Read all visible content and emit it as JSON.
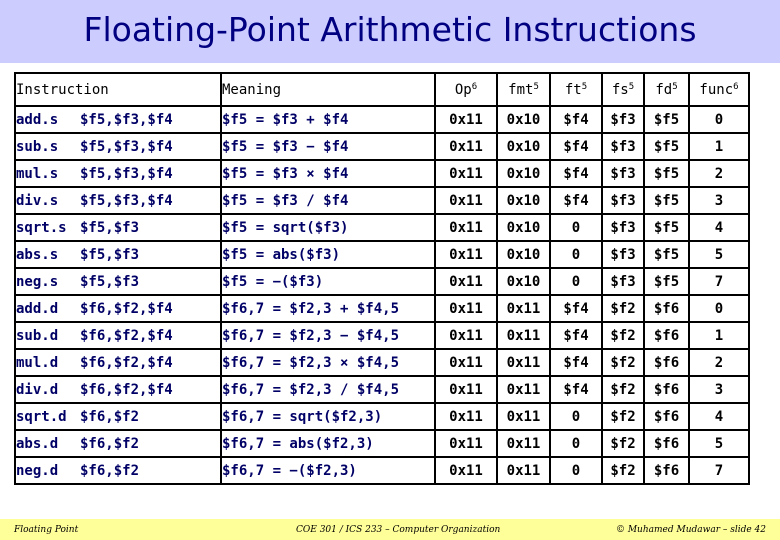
{
  "slide": {
    "title": "Floating-Point Arithmetic Instructions",
    "colors": {
      "title_bg": "#ccccff",
      "title_text": "#000080",
      "instruction_text": "#000066",
      "footer_bg": "#ffff99"
    }
  },
  "table": {
    "headers": {
      "instruction": "Instruction",
      "meaning": "Meaning",
      "op": {
        "label": "Op",
        "bits": "6"
      },
      "fmt": {
        "label": "fmt",
        "bits": "5"
      },
      "ft": {
        "label": "ft",
        "bits": "5"
      },
      "fs": {
        "label": "fs",
        "bits": "5"
      },
      "fd": {
        "label": "fd",
        "bits": "5"
      },
      "func": {
        "label": "func",
        "bits": "6"
      }
    },
    "rows": [
      {
        "mnemonic": "add.s",
        "operands": "$f5,$f3,$f4",
        "meaning": "$f5 = $f3 + $f4",
        "op": "0x11",
        "fmt": "0x10",
        "ft": "$f4",
        "fs": "$f3",
        "fd": "$f5",
        "func": "0"
      },
      {
        "mnemonic": "sub.s",
        "operands": "$f5,$f3,$f4",
        "meaning": "$f5 = $f3 − $f4",
        "op": "0x11",
        "fmt": "0x10",
        "ft": "$f4",
        "fs": "$f3",
        "fd": "$f5",
        "func": "1"
      },
      {
        "mnemonic": "mul.s",
        "operands": "$f5,$f3,$f4",
        "meaning": "$f5 = $f3 × $f4",
        "op": "0x11",
        "fmt": "0x10",
        "ft": "$f4",
        "fs": "$f3",
        "fd": "$f5",
        "func": "2"
      },
      {
        "mnemonic": "div.s",
        "operands": "$f5,$f3,$f4",
        "meaning": "$f5 = $f3 / $f4",
        "op": "0x11",
        "fmt": "0x10",
        "ft": "$f4",
        "fs": "$f3",
        "fd": "$f5",
        "func": "3"
      },
      {
        "mnemonic": "sqrt.s",
        "operands": "$f5,$f3",
        "meaning": "$f5 = sqrt($f3)",
        "op": "0x11",
        "fmt": "0x10",
        "ft": "0",
        "fs": "$f3",
        "fd": "$f5",
        "func": "4"
      },
      {
        "mnemonic": "abs.s",
        "operands": "$f5,$f3",
        "meaning": "$f5 = abs($f3)",
        "op": "0x11",
        "fmt": "0x10",
        "ft": "0",
        "fs": "$f3",
        "fd": "$f5",
        "func": "5"
      },
      {
        "mnemonic": "neg.s",
        "operands": "$f5,$f3",
        "meaning": "$f5 = −($f3)",
        "op": "0x11",
        "fmt": "0x10",
        "ft": "0",
        "fs": "$f3",
        "fd": "$f5",
        "func": "7"
      },
      {
        "mnemonic": "add.d",
        "operands": "$f6,$f2,$f4",
        "meaning": "$f6,7 = $f2,3 + $f4,5",
        "op": "0x11",
        "fmt": "0x11",
        "ft": "$f4",
        "fs": "$f2",
        "fd": "$f6",
        "func": "0"
      },
      {
        "mnemonic": "sub.d",
        "operands": "$f6,$f2,$f4",
        "meaning": "$f6,7 = $f2,3 − $f4,5",
        "op": "0x11",
        "fmt": "0x11",
        "ft": "$f4",
        "fs": "$f2",
        "fd": "$f6",
        "func": "1"
      },
      {
        "mnemonic": "mul.d",
        "operands": "$f6,$f2,$f4",
        "meaning": "$f6,7 = $f2,3 × $f4,5",
        "op": "0x11",
        "fmt": "0x11",
        "ft": "$f4",
        "fs": "$f2",
        "fd": "$f6",
        "func": "2"
      },
      {
        "mnemonic": "div.d",
        "operands": "$f6,$f2,$f4",
        "meaning": "$f6,7 = $f2,3 / $f4,5",
        "op": "0x11",
        "fmt": "0x11",
        "ft": "$f4",
        "fs": "$f2",
        "fd": "$f6",
        "func": "3"
      },
      {
        "mnemonic": "sqrt.d",
        "operands": "$f6,$f2",
        "meaning": "$f6,7 = sqrt($f2,3)",
        "op": "0x11",
        "fmt": "0x11",
        "ft": "0",
        "fs": "$f2",
        "fd": "$f6",
        "func": "4"
      },
      {
        "mnemonic": "abs.d",
        "operands": "$f6,$f2",
        "meaning": "$f6,7 = abs($f2,3)",
        "op": "0x11",
        "fmt": "0x11",
        "ft": "0",
        "fs": "$f2",
        "fd": "$f6",
        "func": "5"
      },
      {
        "mnemonic": "neg.d",
        "operands": "$f6,$f2",
        "meaning": "$f6,7 = −($f2,3)",
        "op": "0x11",
        "fmt": "0x11",
        "ft": "0",
        "fs": "$f2",
        "fd": "$f6",
        "func": "7"
      }
    ]
  },
  "footer": {
    "left": "Floating Point",
    "center": "COE 301 / ICS 233 – Computer Organization",
    "right": "© Muhamed Mudawar – slide 42"
  }
}
